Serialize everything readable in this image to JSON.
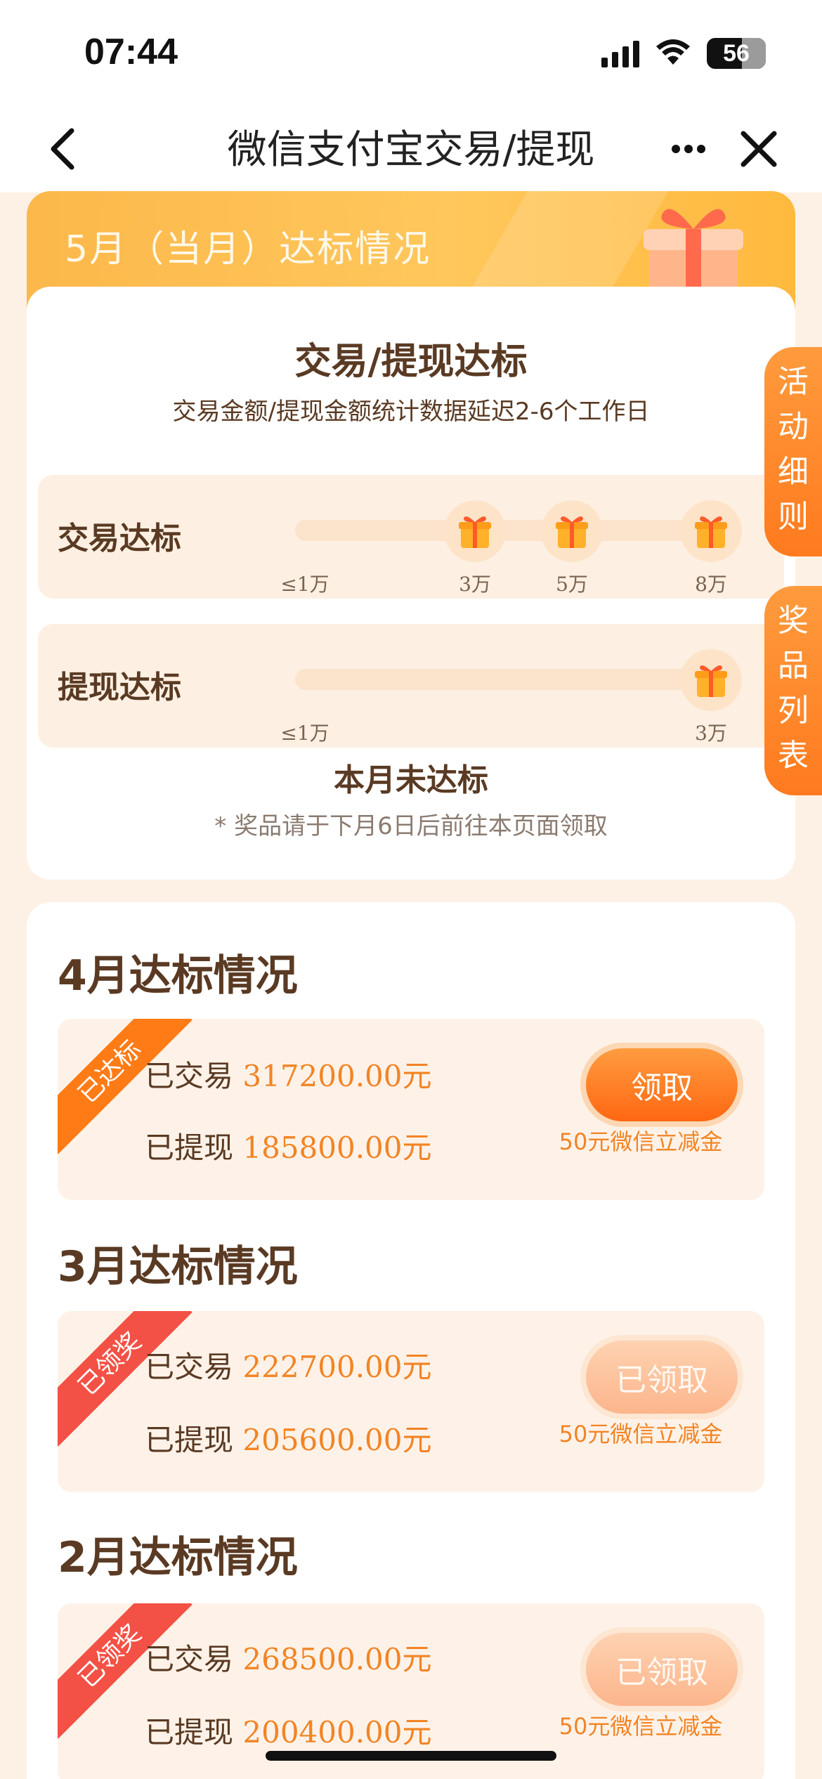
{
  "status_bar": {
    "time": "07:44",
    "battery": "56"
  },
  "nav": {
    "title": "微信支付宝交易/提现"
  },
  "current_month": {
    "banner_title": "5月（当月）达标情况",
    "heading": "交易/提现达标",
    "subtitle": "交易金额/提现金额统计数据延迟2-6个工作日",
    "trade_track": {
      "label": "交易达标",
      "ticks": [
        "≤1万",
        "3万",
        "5万",
        "8万"
      ]
    },
    "withdraw_track": {
      "label": "提现达标",
      "ticks": [
        "≤1万",
        "3万"
      ]
    },
    "status": "本月未达标",
    "note": "* 奖品请于下月6日后前往本页面领取"
  },
  "side_tabs": {
    "rules": "活动细则",
    "prizes": "奖品列表"
  },
  "history": [
    {
      "title": "4月达标情况",
      "ribbon": "已达标",
      "trade_label": "已交易",
      "trade_amount": "317200.00元",
      "withdraw_label": "已提现",
      "withdraw_amount": "185800.00元",
      "button": "领取",
      "prize": "50元微信立减金"
    },
    {
      "title": "3月达标情况",
      "ribbon": "已领奖",
      "trade_label": "已交易",
      "trade_amount": "222700.00元",
      "withdraw_label": "已提现",
      "withdraw_amount": "205600.00元",
      "button": "已领取",
      "prize": "50元微信立减金"
    },
    {
      "title": "2月达标情况",
      "ribbon": "已领奖",
      "trade_label": "已交易",
      "trade_amount": "268500.00元",
      "withdraw_label": "已提现",
      "withdraw_amount": "200400.00元",
      "button": "已领取",
      "prize": "50元微信立减金"
    }
  ]
}
